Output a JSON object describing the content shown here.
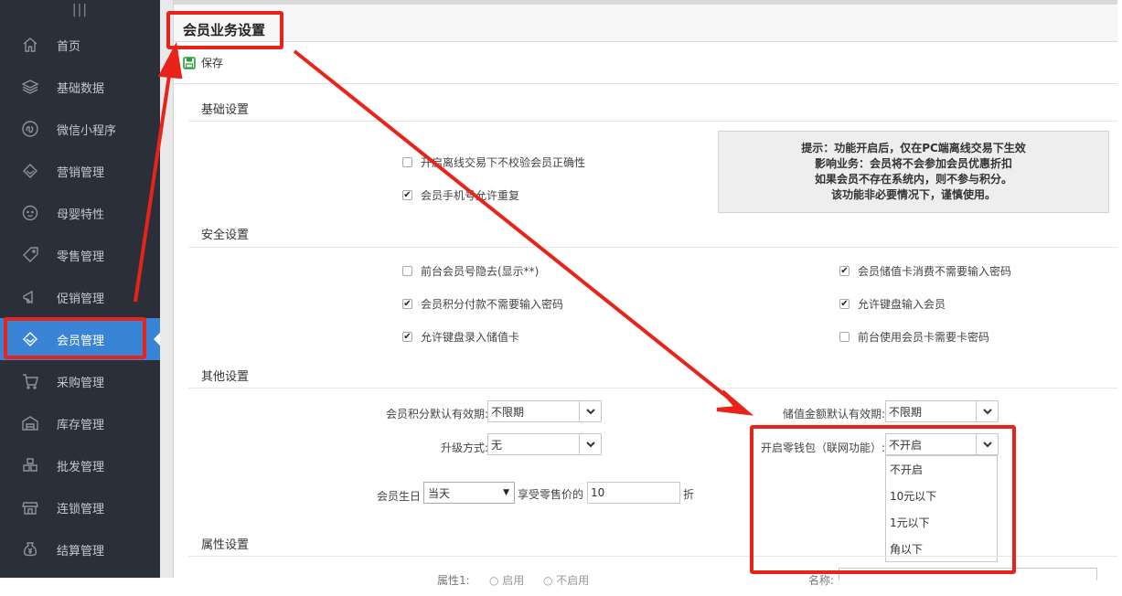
{
  "sidebar": {
    "grip": "|||",
    "items": [
      {
        "label": "首页",
        "icon": "home-icon"
      },
      {
        "label": "基础数据",
        "icon": "layers-icon"
      },
      {
        "label": "微信小程序",
        "icon": "mini-program-icon"
      },
      {
        "label": "营销管理",
        "icon": "diamond-icon"
      },
      {
        "label": "母婴特性",
        "icon": "baby-face-icon"
      },
      {
        "label": "零售管理",
        "icon": "tag-icon"
      },
      {
        "label": "促销管理",
        "icon": "megaphone-icon"
      },
      {
        "label": "会员管理",
        "icon": "gem-icon",
        "active": true
      },
      {
        "label": "采购管理",
        "icon": "cart-icon"
      },
      {
        "label": "库存管理",
        "icon": "warehouse-icon"
      },
      {
        "label": "批发管理",
        "icon": "boxes-icon"
      },
      {
        "label": "连锁管理",
        "icon": "store-icon"
      },
      {
        "label": "结算管理",
        "icon": "yen-bag-icon"
      }
    ]
  },
  "header": {
    "title": "会员业务设置"
  },
  "toolbar": {
    "save_label": "保存",
    "save_icon": "save-icon"
  },
  "basic": {
    "title": "基础设置",
    "offline_no_verify": {
      "label": "开启离线交易下不校验会员正确性",
      "checked": false
    },
    "phone_duplicate": {
      "label": "会员手机号允许重复",
      "checked": true
    },
    "tip": {
      "line1": "提示：功能开启后，仅在PC端离线交易下生效",
      "line2": "影响业务：会员将不会参加会员优惠折扣",
      "line3": "如果会员不存在系统内，则不参与积分。",
      "line4": "该功能非必要情况下，谨慎使用。"
    }
  },
  "security": {
    "title": "安全设置",
    "hide_card_no": {
      "label": "前台会员号隐去(显示**)",
      "checked": false
    },
    "points_no_pwd": {
      "label": "会员积分付款不需要输入密码",
      "checked": true
    },
    "keyboard_card": {
      "label": "允许键盘录入储值卡",
      "checked": true
    },
    "stored_no_pwd": {
      "label": "会员储值卡消费不需要输入密码",
      "checked": true
    },
    "keyboard_member": {
      "label": "允许键盘输入会员",
      "checked": true
    },
    "card_pwd": {
      "label": "前台使用会员卡需要卡密码",
      "checked": false
    }
  },
  "other": {
    "title": "其他设置",
    "points_validity": {
      "label": "会员积分默认有效期:",
      "value": "不限期"
    },
    "upgrade_mode": {
      "label": "升级方式:",
      "value": "无"
    },
    "birthday": {
      "label": "会员生日",
      "value": "当天",
      "mid_label": "享受零售价的",
      "discount": "10",
      "unit": "折"
    },
    "stored_validity": {
      "label": "储值金额默认有效期:",
      "value": "不限期"
    },
    "wallet": {
      "label": "开启零钱包（联网功能）:",
      "value": "不开启",
      "options": [
        "不开启",
        "10元以下",
        "1元以下",
        "角以下"
      ]
    }
  },
  "attributes": {
    "title": "属性设置",
    "attr1_label": "属性1:",
    "opt_enable": "启用",
    "opt_disable": "不启用",
    "name_label": "名称:"
  },
  "colors": {
    "sidebar_bg": "#2b2f3a",
    "active": "#3a84d6",
    "highlight": "#e8231a"
  }
}
